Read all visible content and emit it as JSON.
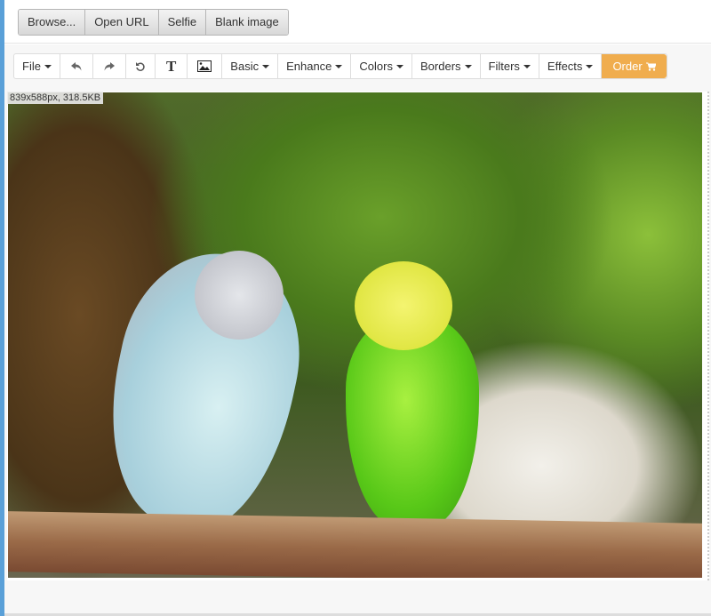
{
  "source_buttons": [
    "Browse...",
    "Open URL",
    "Selfie",
    "Blank image"
  ],
  "toolbar": {
    "file": "File",
    "undo_icon": "undo-icon",
    "redo_icon": "redo-icon",
    "rotate_icon": "rotate-icon",
    "text_icon": "text-icon",
    "image_icon": "image-icon",
    "text_glyph": "T",
    "menus": [
      "Basic",
      "Enhance",
      "Colors",
      "Borders",
      "Filters",
      "Effects"
    ],
    "order": "Order",
    "order_color": "#f0ad4e"
  },
  "canvas": {
    "info": "839x588px, 318.5KB"
  }
}
